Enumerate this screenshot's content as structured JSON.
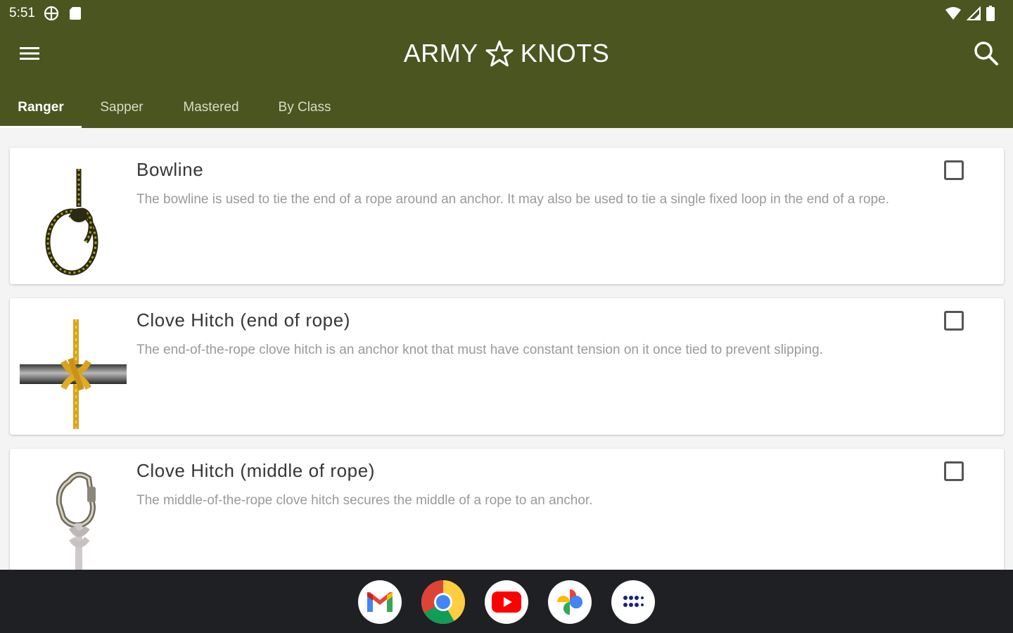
{
  "status_bar": {
    "time": "5:51",
    "left_icons": [
      "vpn-icon",
      "sd-card-icon"
    ],
    "right_icons": [
      "wifi-icon",
      "signal-icon",
      "battery-icon"
    ]
  },
  "app_bar": {
    "title_left": "ARMY",
    "title_right": "KNOTS",
    "title_icon": "star-outline-icon",
    "menu_icon": "hamburger-menu-icon",
    "search_icon": "search-icon",
    "background_color": "#4a5520"
  },
  "tabs": [
    {
      "label": "Ranger",
      "active": true
    },
    {
      "label": "Sapper",
      "active": false
    },
    {
      "label": "Mastered",
      "active": false
    },
    {
      "label": "By Class",
      "active": false
    }
  ],
  "knots": [
    {
      "title": "Bowline",
      "description": "The bowline is used to tie the end of a rope around an anchor. It may also be used to tie a single fixed loop in the end of a rope.",
      "checked": false,
      "image": "bowline-knot-image"
    },
    {
      "title": "Clove Hitch (end of rope)",
      "description": "The end-of-the-rope clove hitch is an anchor knot that must have constant tension on it once tied to prevent slipping.",
      "checked": false,
      "image": "clove-hitch-end-image"
    },
    {
      "title": "Clove Hitch (middle of rope)",
      "description": "The middle-of-the-rope clove hitch secures the middle of a rope to an anchor.",
      "checked": false,
      "image": "clove-hitch-middle-image"
    }
  ],
  "dock": {
    "apps": [
      "gmail-icon",
      "chrome-icon",
      "youtube-icon",
      "photos-icon",
      "app-drawer-icon"
    ]
  }
}
